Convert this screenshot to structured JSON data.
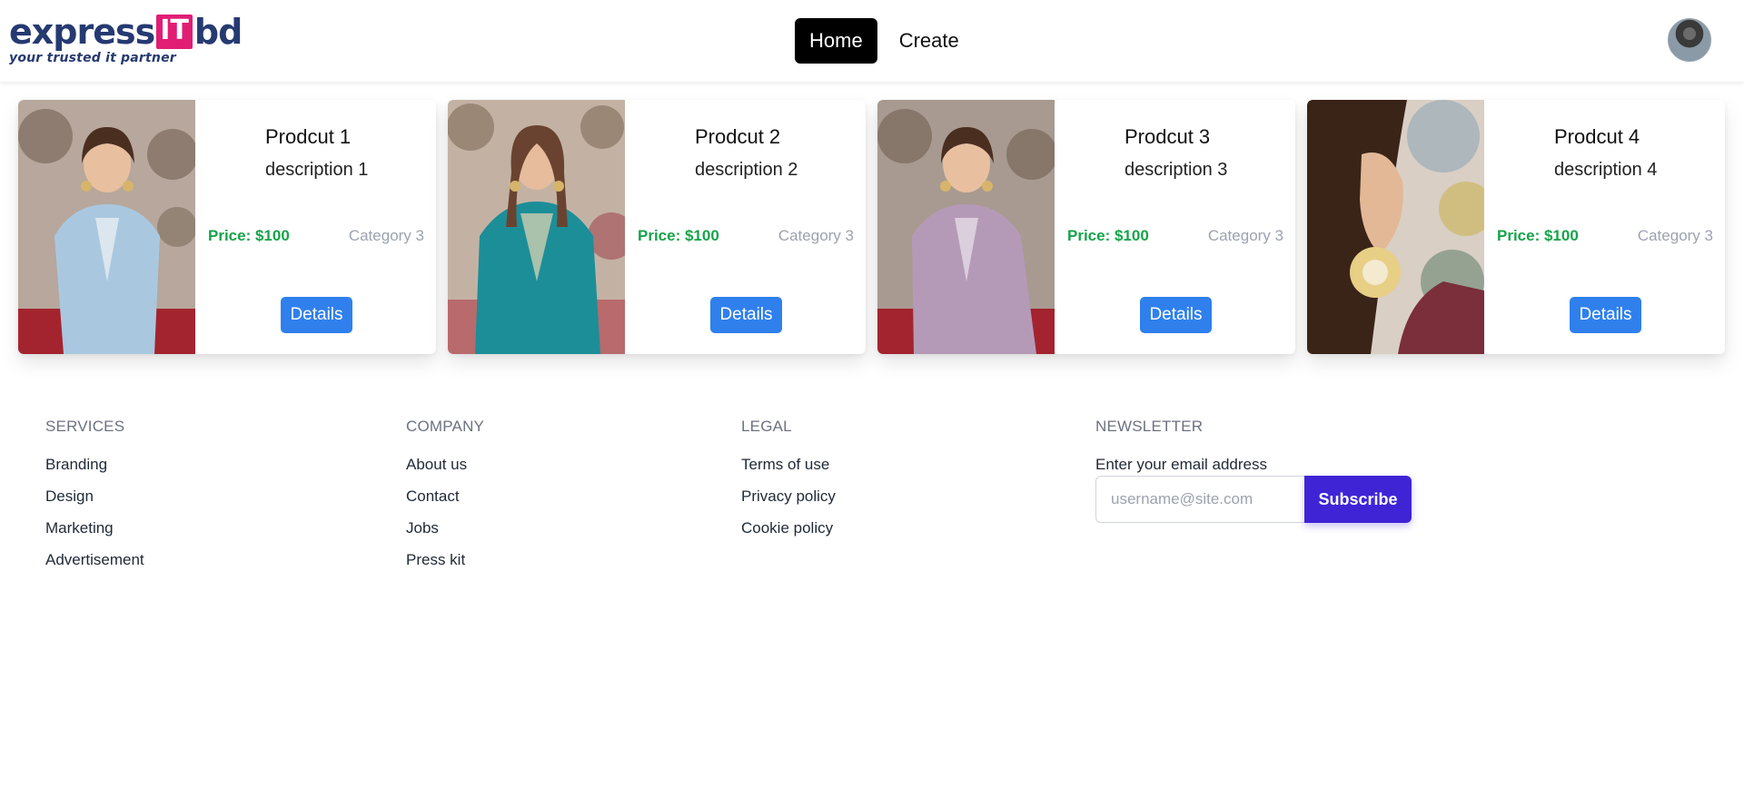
{
  "header": {
    "logo": {
      "word_express": "express",
      "word_it": "IT",
      "word_bd": "bd",
      "tagline": "your trusted it partner",
      "colors": {
        "navy": "#263a72",
        "pink": "#e11d74"
      }
    },
    "nav": [
      {
        "label": "Home",
        "active": true
      },
      {
        "label": "Create",
        "active": false
      }
    ]
  },
  "products": [
    {
      "title": "Prodcut 1",
      "description": "description 1",
      "price": "Price: $100",
      "category": "Category 3",
      "button": "Details",
      "dress_color": "#a9c8e0"
    },
    {
      "title": "Prodcut 2",
      "description": "description 2",
      "price": "Price: $100",
      "category": "Category 3",
      "button": "Details",
      "dress_color": "#1c8e98"
    },
    {
      "title": "Prodcut 3",
      "description": "description 3",
      "price": "Price: $100",
      "category": "Category 3",
      "button": "Details",
      "dress_color": "#b59ab8"
    },
    {
      "title": "Prodcut 4",
      "description": "description 4",
      "price": "Price: $100",
      "category": "Category 3",
      "button": "Details",
      "dress_color": "#7a2f3a"
    }
  ],
  "footer": {
    "services": {
      "heading": "SERVICES",
      "links": [
        "Branding",
        "Design",
        "Marketing",
        "Advertisement"
      ]
    },
    "company": {
      "heading": "COMPANY",
      "links": [
        "About us",
        "Contact",
        "Jobs",
        "Press kit"
      ]
    },
    "legal": {
      "heading": "LEGAL",
      "links": [
        "Terms of use",
        "Privacy policy",
        "Cookie policy"
      ]
    },
    "newsletter": {
      "heading": "NEWSLETTER",
      "label": "Enter your email address",
      "placeholder": "username@site.com",
      "button": "Subscribe"
    }
  },
  "colors": {
    "price_green": "#16a34a",
    "details_blue": "#2f80ed",
    "subscribe_indigo": "#3f24d6"
  }
}
